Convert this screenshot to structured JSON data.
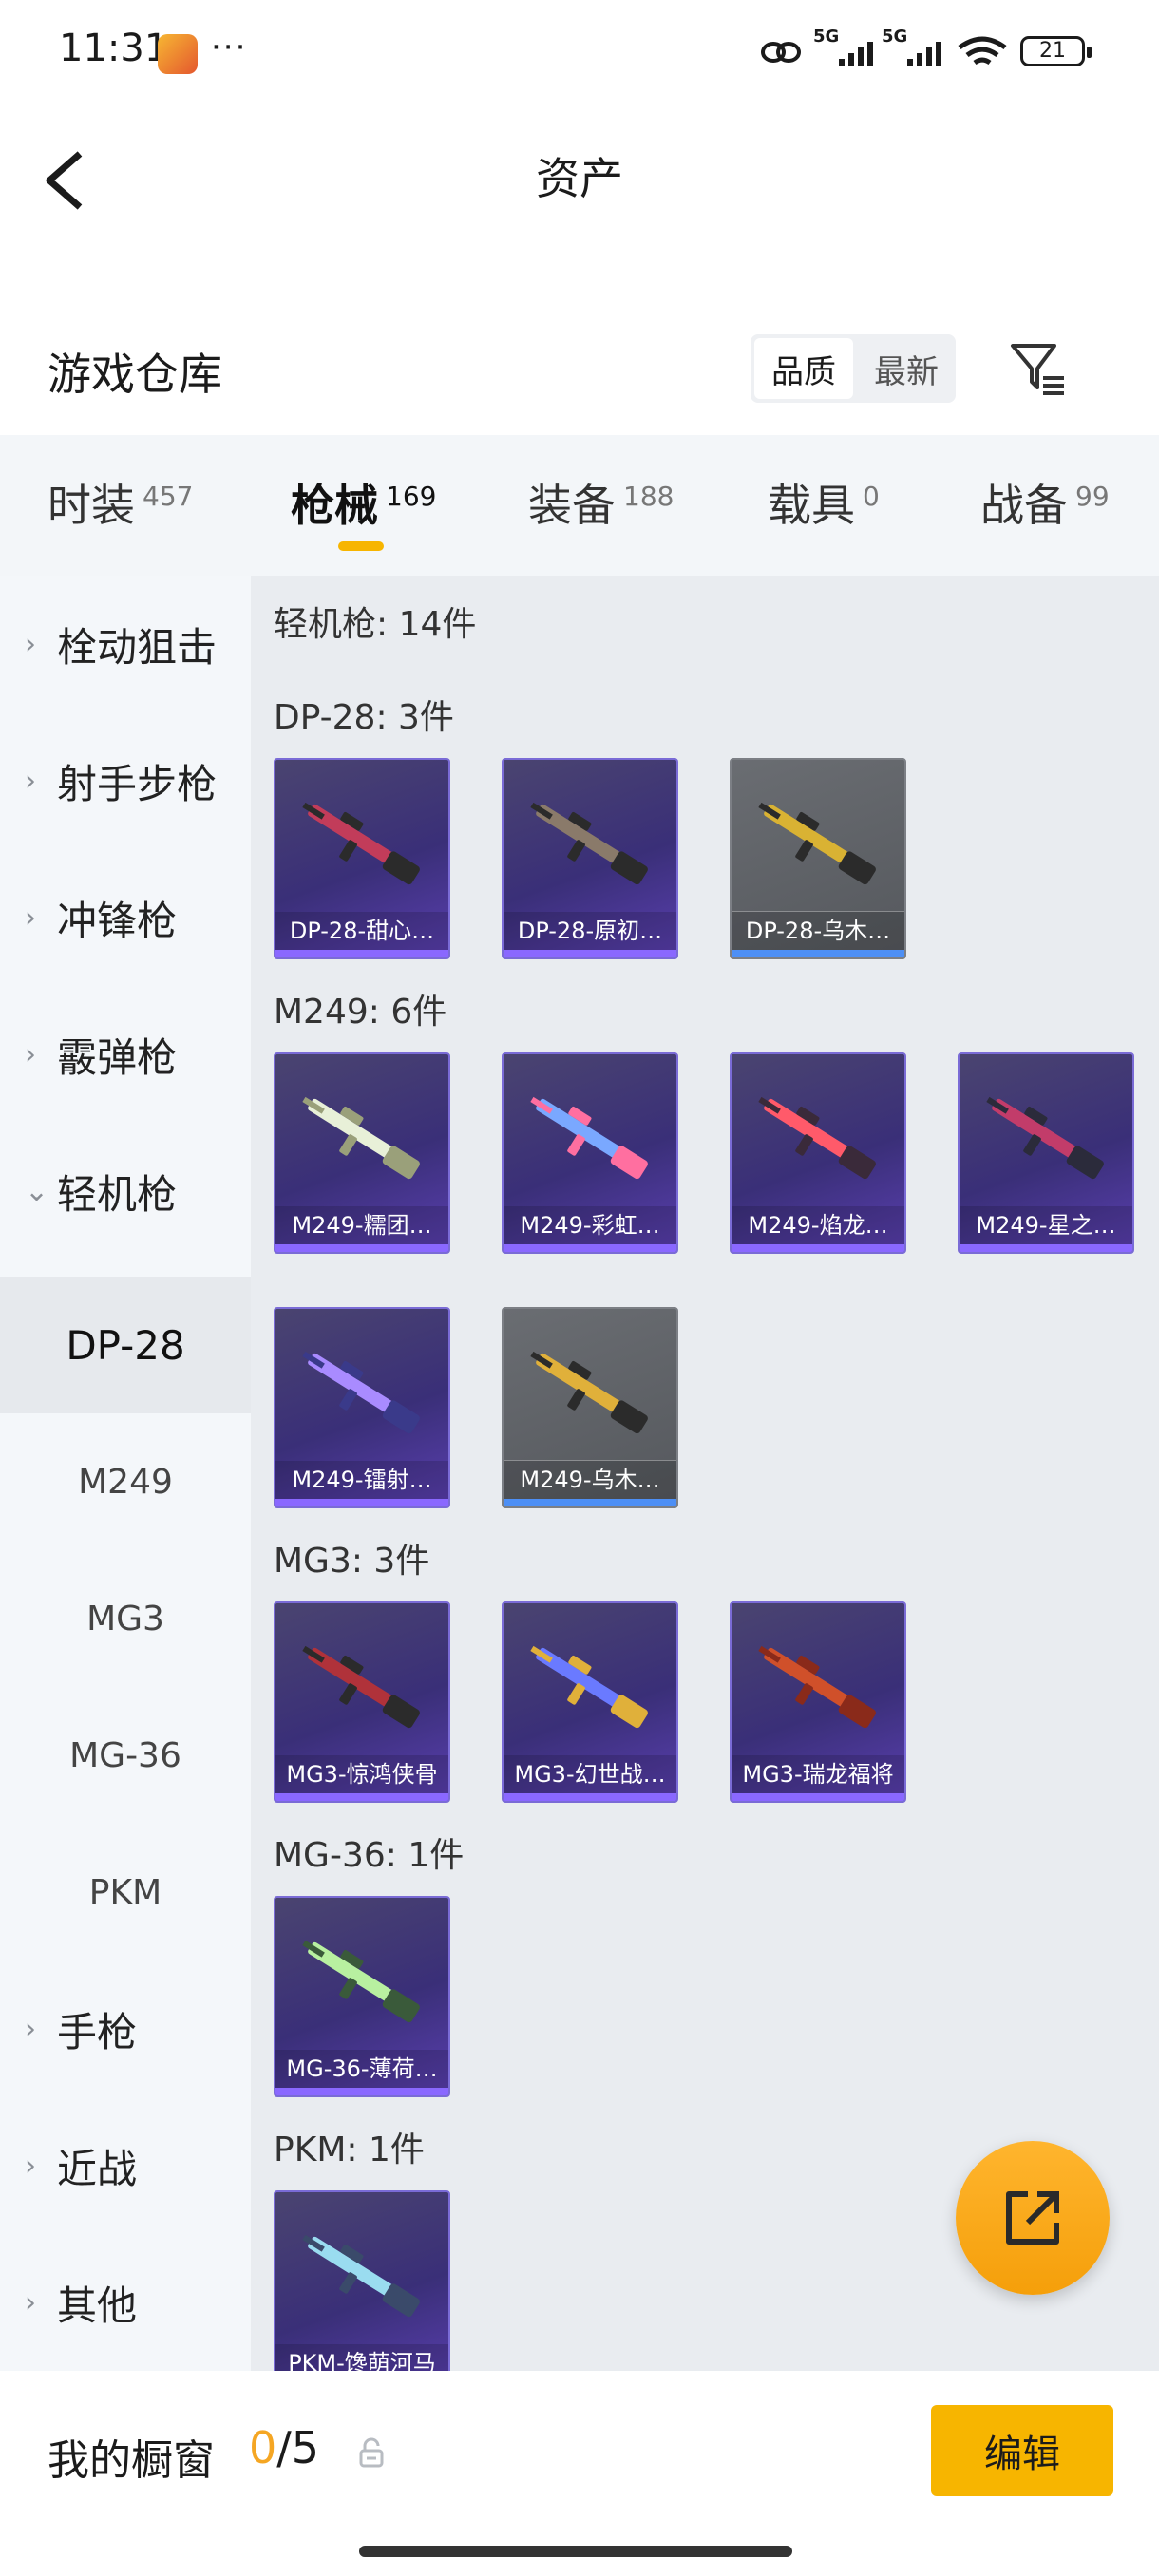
{
  "status_bar": {
    "time": "11:31",
    "dots": "···",
    "battery": "21",
    "sig1": "5G",
    "sig2": "5G"
  },
  "header": {
    "title": "资产"
  },
  "warehouse": {
    "title": "游戏仓库",
    "sort_options": [
      "品质",
      "最新"
    ]
  },
  "tabs": [
    {
      "label": "时装",
      "count": "457"
    },
    {
      "label": "枪械",
      "count": "169"
    },
    {
      "label": "装备",
      "count": "188"
    },
    {
      "label": "载具",
      "count": "0"
    },
    {
      "label": "战备",
      "count": "99"
    }
  ],
  "sidebar": {
    "categories": [
      "栓动狙击",
      "射手步枪",
      "冲锋枪",
      "霰弹枪",
      "轻机枪"
    ],
    "subcategories": [
      "DP-28",
      "M249",
      "MG3",
      "MG-36",
      "PKM"
    ],
    "more": [
      "手枪",
      "近战",
      "其他"
    ]
  },
  "content": {
    "header": "轻机枪: 14件",
    "groups": [
      {
        "label": "DP-28: 3件",
        "items": [
          {
            "name": "DP-28-甜心…",
            "rarity": "purple"
          },
          {
            "name": "DP-28-原初…",
            "rarity": "purple"
          },
          {
            "name": "DP-28-乌木…",
            "rarity": "grey"
          }
        ]
      },
      {
        "label": "M249: 6件",
        "items": [
          {
            "name": "M249-糯团…",
            "rarity": "purple"
          },
          {
            "name": "M249-彩虹…",
            "rarity": "purple"
          },
          {
            "name": "M249-焰龙…",
            "rarity": "purple"
          },
          {
            "name": "M249-星之…",
            "rarity": "purple"
          },
          {
            "name": "M249-镭射…",
            "rarity": "purple"
          },
          {
            "name": "M249-乌木…",
            "rarity": "grey"
          }
        ]
      },
      {
        "label": "MG3: 3件",
        "items": [
          {
            "name": "MG3-惊鸿侠骨",
            "rarity": "purple"
          },
          {
            "name": "MG3-幻世战…",
            "rarity": "purple"
          },
          {
            "name": "MG3-瑞龙福将",
            "rarity": "purple"
          }
        ]
      },
      {
        "label": "MG-36: 1件",
        "items": [
          {
            "name": "MG-36-薄荷…",
            "rarity": "purple"
          }
        ]
      },
      {
        "label": "PKM: 1件",
        "items": [
          {
            "name": "PKM-馋萌河马",
            "rarity": "purple"
          }
        ]
      }
    ]
  },
  "showcase": {
    "title": "我的橱窗",
    "used": "0",
    "sep_total": "/5",
    "edit_label": "编辑"
  },
  "colors": {
    "accent": "#f7b500",
    "purple_rarity": "#8a68ff",
    "grey_rarity_bar": "#4d8ff5"
  }
}
